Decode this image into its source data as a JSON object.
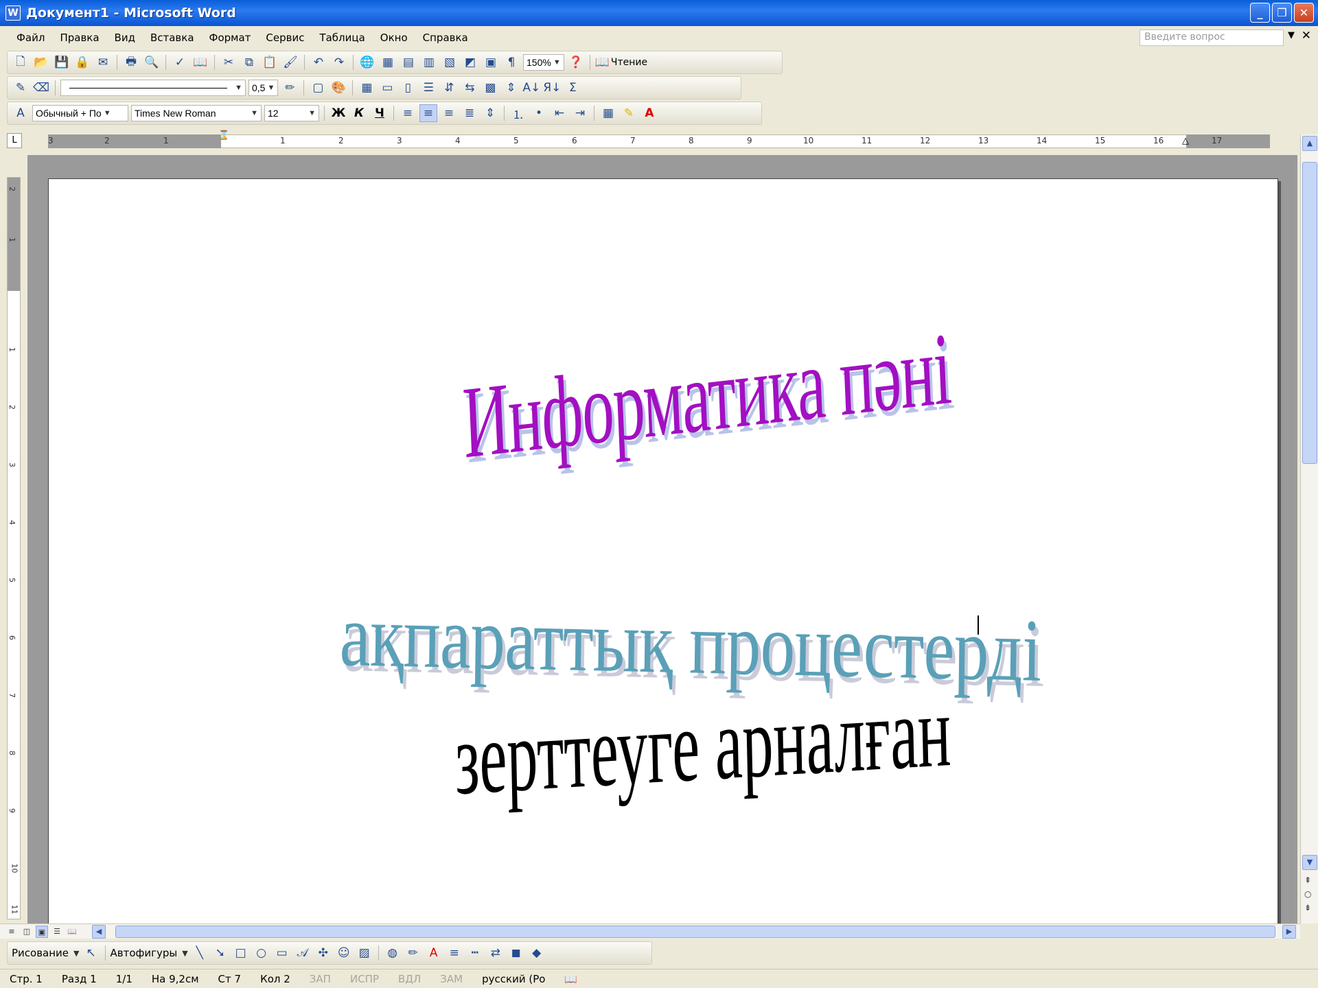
{
  "window": {
    "title": "Документ1 - Microsoft Word",
    "app_icon": "W"
  },
  "menu": [
    "Файл",
    "Правка",
    "Вид",
    "Вставка",
    "Формат",
    "Сервис",
    "Таблица",
    "Окно",
    "Справка"
  ],
  "ask": {
    "placeholder": "Введите вопрос"
  },
  "standard_toolbar": {
    "zoom": "150%",
    "reading_label": "Чтение"
  },
  "drawing_borders_toolbar": {
    "line_weight": "0,5"
  },
  "formatting_toolbar": {
    "style": "Обычный + По",
    "font": "Times New Roman",
    "size": "12",
    "bold": "Ж",
    "italic": "К",
    "underline": "Ч",
    "font_color_letter": "A"
  },
  "ruler": {
    "numbers": [
      "3",
      "2",
      "1",
      "1",
      "2",
      "3",
      "4",
      "5",
      "6",
      "7",
      "8",
      "9",
      "10",
      "11",
      "12",
      "13",
      "14",
      "15",
      "16",
      "17"
    ]
  },
  "vruler": {
    "numbers": [
      "2",
      "1",
      "1",
      "2",
      "3",
      "4",
      "5",
      "6",
      "7",
      "8",
      "9",
      "10",
      "11"
    ]
  },
  "document": {
    "wordart_1": "Информатика пәні",
    "wordart_2": "ақпараттық процестерді",
    "wordart_3": "зерттеуге арналған"
  },
  "drawing_toolbar": {
    "draw_label": "Рисование",
    "autoshapes_label": "Автофигуры"
  },
  "status": {
    "page": "Стр. 1",
    "section": "Разд 1",
    "pages": "1/1",
    "at": "На 9,2см",
    "line": "Ст 7",
    "col": "Кол 2",
    "rec": "ЗАП",
    "trk": "ИСПР",
    "ext": "ВДЛ",
    "ovr": "ЗАМ",
    "language": "русский (Ро"
  },
  "colors": {
    "title_bar": "#0a5fd8",
    "wordart_1": "#a30fc2",
    "wordart_2": "#5aa0b8",
    "wordart_3": "#000000"
  }
}
